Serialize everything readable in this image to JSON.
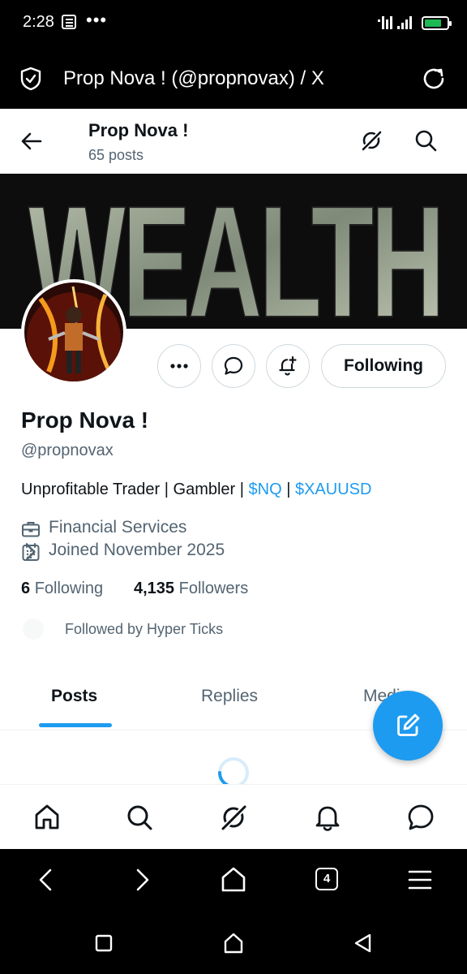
{
  "status_bar": {
    "time": "2:28",
    "dots": "•••"
  },
  "browser": {
    "title": "Prop Nova ! (@propnovax) / X",
    "tab_count": "4"
  },
  "header": {
    "name": "Prop Nova !",
    "posts_count": "65 posts"
  },
  "banner": {
    "word": "WEALTH"
  },
  "actions": {
    "following_label": "Following"
  },
  "profile": {
    "display_name": "Prop Nova !",
    "handle": "@propnovax",
    "bio_text": "Unprofitable Trader | Gambler | ",
    "bio_cashtag_1": "$NQ",
    "bio_separator": " | ",
    "bio_cashtag_2": "$XAUUSD",
    "category": "Financial Services",
    "joined": "Joined November 2025",
    "following_count": "6",
    "following_label": "Following",
    "followers_count": "4,135",
    "followers_label": "Followers",
    "followed_by": "Followed by Hyper Ticks"
  },
  "tabs": [
    {
      "label": "Posts"
    },
    {
      "label": "Replies"
    },
    {
      "label": "Media"
    }
  ],
  "colors": {
    "accent": "#1d9bf0",
    "text_primary": "#0f1419",
    "text_secondary": "#536471",
    "border": "#cfd9de"
  }
}
